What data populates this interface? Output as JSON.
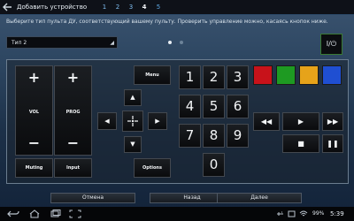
{
  "header": {
    "back_icon": "arrow-left-icon",
    "title": "Добавить устройство",
    "steps": [
      "1",
      "2",
      "3",
      "4",
      "5"
    ],
    "active_step": "4"
  },
  "instruction": "Выберите тип пульта ДУ, соответствующий вашему пульту. Проверить управление можно, касаясь кнопок ниже.",
  "type_select": {
    "value": "Тип 2",
    "icon": "triangle-down-icon"
  },
  "page_dots": {
    "count": 2,
    "active": 1
  },
  "power_button": {
    "label": "I/⏻",
    "icon": "power-icon"
  },
  "remote": {
    "vol": {
      "plus": "+",
      "label": "VOL",
      "minus": "−"
    },
    "prog": {
      "plus": "+",
      "label": "PROG",
      "minus": "−"
    },
    "muting": "Muting",
    "input": "Input",
    "menu": "Menu",
    "options": "Options",
    "dpad": {
      "up": "▲",
      "left": "◀",
      "center": "·✦·",
      "right": "▶",
      "down": "▼"
    },
    "digits": [
      "1",
      "2",
      "3",
      "4",
      "5",
      "6",
      "7",
      "8",
      "9",
      "0"
    ],
    "color_buttons": [
      {
        "name": "red",
        "color": "#c8121a"
      },
      {
        "name": "green",
        "color": "#1e9a22"
      },
      {
        "name": "yellow",
        "color": "#e6a31a"
      },
      {
        "name": "blue",
        "color": "#1f4fd2"
      }
    ],
    "transport": {
      "rewind": "◀◀",
      "play": "▶",
      "fast_forward": "▶▶",
      "stop": "■",
      "pause": "❚❚"
    }
  },
  "footer": {
    "cancel": "Отмена",
    "back": "Назад",
    "next": "Далее"
  },
  "system_bar": {
    "nav_icons": [
      "back-nav-icon",
      "home-nav-icon",
      "recent-apps-icon",
      "screenshot-icon"
    ],
    "status_icons": [
      "usb-icon",
      "notification-icon",
      "wifi-icon"
    ],
    "battery": "99%",
    "time": "5:39"
  }
}
